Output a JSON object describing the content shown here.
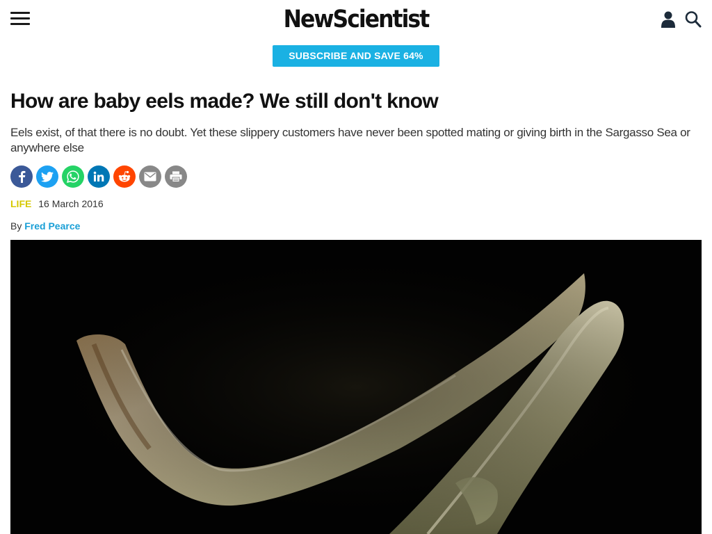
{
  "header": {
    "logo_text": "NewScientist",
    "subscribe_label": "SUBSCRIBE AND SAVE 64%"
  },
  "article": {
    "headline": "How are baby eels made? We still don't know",
    "standfirst": "Eels exist, of that there is no doubt. Yet these slippery customers have never been spotted mating or giving birth in the Sargasso Sea or anywhere else",
    "category": "LIFE",
    "date": "16 March 2016",
    "by_label": "By",
    "author": "Fred Pearce"
  },
  "share_icons": [
    "facebook-icon",
    "twitter-icon",
    "whatsapp-icon",
    "linkedin-icon",
    "reddit-icon",
    "email-icon",
    "print-icon"
  ],
  "colors": {
    "subscribe_bg": "#1ab1e3",
    "category": "#d6c800",
    "author_link": "#1a9fd6",
    "facebook": "#3b5998",
    "twitter": "#1da1f2",
    "whatsapp": "#25d366",
    "linkedin": "#0077b5",
    "reddit": "#ff4500",
    "email": "#888888",
    "print": "#888888"
  },
  "hero_image": {
    "subject": "two eels swimming"
  }
}
